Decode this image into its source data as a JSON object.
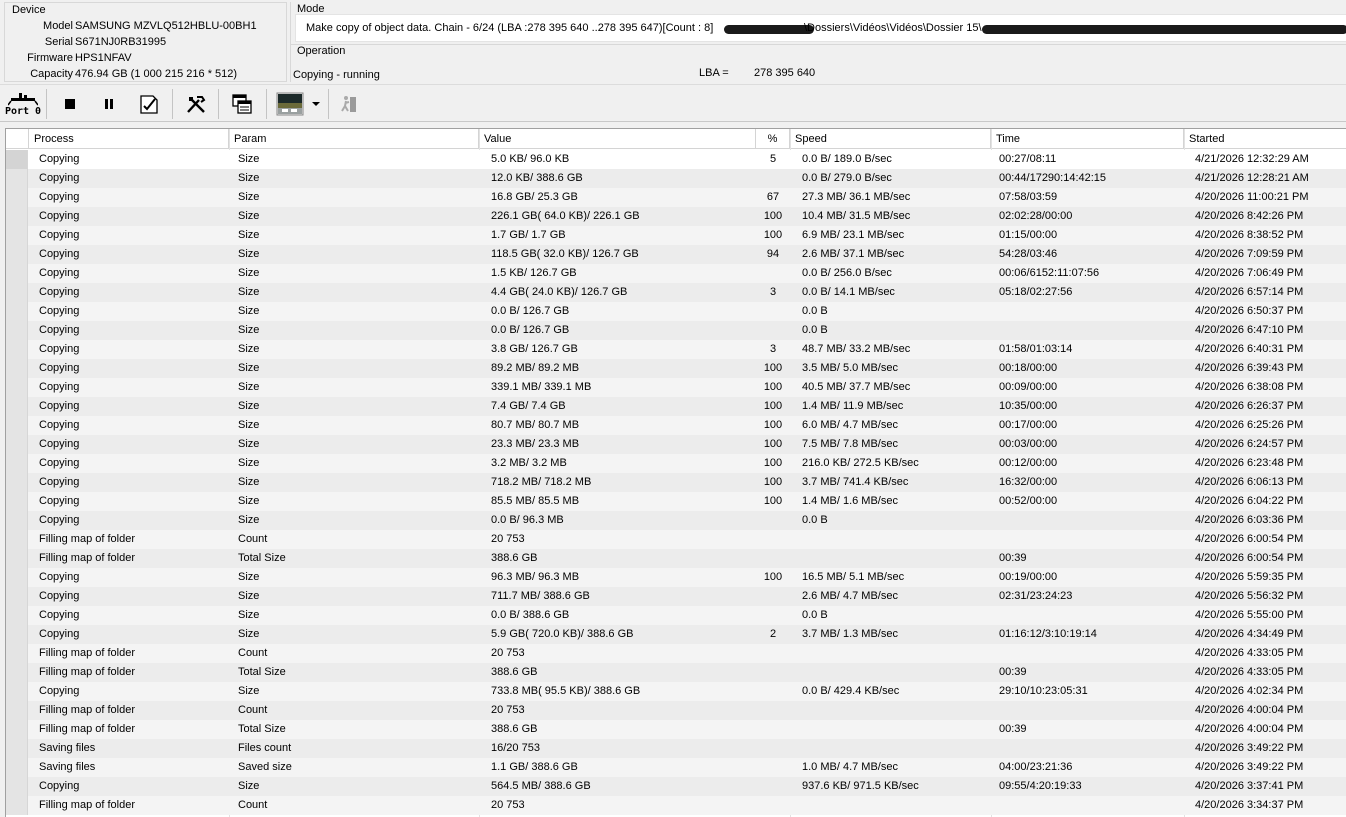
{
  "device": {
    "title": "Device",
    "model_label": "Model",
    "model": "SAMSUNG MZVLQ512HBLU-00BH1",
    "serial_label": "Serial",
    "serial": "S671NJ0RB31995",
    "firmware_label": "Firmware",
    "firmware": "HPS1NFAV",
    "capacity_label": "Capacity",
    "capacity": "476.94 GB (1 000 215 216 * 512)"
  },
  "mode": {
    "title": "Mode",
    "text": "Make copy of object data. Chain - 6/24 (LBA :278 395 640 ..278 395 647)[Count :   8]",
    "path_visible": "\\Dossiers\\Vidéos\\Vidéos\\Dossier 15\\"
  },
  "operation": {
    "title": "Operation",
    "status": "Copying - running",
    "lba_label": "LBA =",
    "lba_value": "278 395 640"
  },
  "toolbar": {
    "port_label": "Port 0",
    "icons": [
      "port-icon",
      "stop-icon",
      "pause-icon",
      "checklist-icon",
      "tools-icon",
      "copy-windows-icon",
      "thumbnail-icon",
      "dropdown-arrow-icon",
      "exit-icon"
    ]
  },
  "table": {
    "headers": [
      "Process",
      "Param",
      "Value",
      "%",
      "Speed",
      "Time",
      "Started"
    ],
    "rows": [
      [
        "Copying",
        "Size",
        "5.0 KB/ 96.0 KB",
        "5",
        "0.0 B/ 189.0 B/sec",
        "00:27/08:11",
        "4/21/2026 12:32:29 AM"
      ],
      [
        "Copying",
        "Size",
        "12.0 KB/ 388.6 GB",
        "",
        "0.0 B/ 279.0 B/sec",
        "00:44/17290:14:42:15",
        "4/21/2026 12:28:21 AM"
      ],
      [
        "Copying",
        "Size",
        "16.8 GB/ 25.3 GB",
        "67",
        "27.3 MB/ 36.1 MB/sec",
        "07:58/03:59",
        "4/20/2026 11:00:21 PM"
      ],
      [
        "Copying",
        "Size",
        "226.1 GB( 64.0 KB)/ 226.1 GB",
        "100",
        "10.4 MB/ 31.5 MB/sec",
        "02:02:28/00:00",
        "4/20/2026 8:42:26 PM"
      ],
      [
        "Copying",
        "Size",
        "1.7 GB/ 1.7 GB",
        "100",
        "6.9 MB/ 23.1 MB/sec",
        "01:15/00:00",
        "4/20/2026 8:38:52 PM"
      ],
      [
        "Copying",
        "Size",
        "118.5 GB( 32.0 KB)/ 126.7 GB",
        "94",
        "2.6 MB/ 37.1 MB/sec",
        "54:28/03:46",
        "4/20/2026 7:09:59 PM"
      ],
      [
        "Copying",
        "Size",
        "1.5 KB/ 126.7 GB",
        "",
        "0.0 B/ 256.0 B/sec",
        "00:06/6152:11:07:56",
        "4/20/2026 7:06:49 PM"
      ],
      [
        "Copying",
        "Size",
        "4.4 GB( 24.0 KB)/ 126.7 GB",
        "3",
        "0.0 B/ 14.1 MB/sec",
        "05:18/02:27:56",
        "4/20/2026 6:57:14 PM"
      ],
      [
        "Copying",
        "Size",
        "0.0 B/ 126.7 GB",
        "",
        "0.0 B",
        "",
        "4/20/2026 6:50:37 PM"
      ],
      [
        "Copying",
        "Size",
        "0.0 B/ 126.7 GB",
        "",
        "0.0 B",
        "",
        "4/20/2026 6:47:10 PM"
      ],
      [
        "Copying",
        "Size",
        "3.8 GB/ 126.7 GB",
        "3",
        "48.7 MB/ 33.2 MB/sec",
        "01:58/01:03:14",
        "4/20/2026 6:40:31 PM"
      ],
      [
        "Copying",
        "Size",
        "89.2 MB/ 89.2 MB",
        "100",
        "3.5 MB/ 5.0 MB/sec",
        "00:18/00:00",
        "4/20/2026 6:39:43 PM"
      ],
      [
        "Copying",
        "Size",
        "339.1 MB/ 339.1 MB",
        "100",
        "40.5 MB/ 37.7 MB/sec",
        "00:09/00:00",
        "4/20/2026 6:38:08 PM"
      ],
      [
        "Copying",
        "Size",
        "7.4 GB/ 7.4 GB",
        "100",
        "1.4 MB/ 11.9 MB/sec",
        "10:35/00:00",
        "4/20/2026 6:26:37 PM"
      ],
      [
        "Copying",
        "Size",
        "80.7 MB/ 80.7 MB",
        "100",
        "6.0 MB/ 4.7 MB/sec",
        "00:17/00:00",
        "4/20/2026 6:25:26 PM"
      ],
      [
        "Copying",
        "Size",
        "23.3 MB/ 23.3 MB",
        "100",
        "7.5 MB/ 7.8 MB/sec",
        "00:03/00:00",
        "4/20/2026 6:24:57 PM"
      ],
      [
        "Copying",
        "Size",
        "3.2 MB/ 3.2 MB",
        "100",
        "216.0 KB/ 272.5 KB/sec",
        "00:12/00:00",
        "4/20/2026 6:23:48 PM"
      ],
      [
        "Copying",
        "Size",
        "718.2 MB/ 718.2 MB",
        "100",
        "3.7 MB/ 741.4 KB/sec",
        "16:32/00:00",
        "4/20/2026 6:06:13 PM"
      ],
      [
        "Copying",
        "Size",
        "85.5 MB/ 85.5 MB",
        "100",
        "1.4 MB/ 1.6 MB/sec",
        "00:52/00:00",
        "4/20/2026 6:04:22 PM"
      ],
      [
        "Copying",
        "Size",
        "0.0 B/ 96.3 MB",
        "",
        "0.0 B",
        "",
        "4/20/2026 6:03:36 PM"
      ],
      [
        "Filling map of folder",
        "Count",
        "20 753",
        "",
        "",
        "",
        "4/20/2026 6:00:54 PM"
      ],
      [
        "Filling map of folder",
        "Total Size",
        "388.6 GB",
        "",
        "",
        "00:39",
        "4/20/2026 6:00:54 PM"
      ],
      [
        "Copying",
        "Size",
        "96.3 MB/ 96.3 MB",
        "100",
        "16.5 MB/ 5.1 MB/sec",
        "00:19/00:00",
        "4/20/2026 5:59:35 PM"
      ],
      [
        "Copying",
        "Size",
        "711.7 MB/ 388.6 GB",
        "",
        "2.6 MB/ 4.7 MB/sec",
        "02:31/23:24:23",
        "4/20/2026 5:56:32 PM"
      ],
      [
        "Copying",
        "Size",
        "0.0 B/ 388.6 GB",
        "",
        "0.0 B",
        "",
        "4/20/2026 5:55:00 PM"
      ],
      [
        "Copying",
        "Size",
        "5.9 GB( 720.0 KB)/ 388.6 GB",
        "2",
        "3.7 MB/ 1.3 MB/sec",
        "01:16:12/3:10:19:14",
        "4/20/2026 4:34:49 PM"
      ],
      [
        "Filling map of folder",
        "Count",
        "20 753",
        "",
        "",
        "",
        "4/20/2026 4:33:05 PM"
      ],
      [
        "Filling map of folder",
        "Total Size",
        "388.6 GB",
        "",
        "",
        "00:39",
        "4/20/2026 4:33:05 PM"
      ],
      [
        "Copying",
        "Size",
        "733.8 MB( 95.5 KB)/ 388.6 GB",
        "",
        "0.0 B/ 429.4 KB/sec",
        "29:10/10:23:05:31",
        "4/20/2026 4:02:34 PM"
      ],
      [
        "Filling map of folder",
        "Count",
        "20 753",
        "",
        "",
        "",
        "4/20/2026 4:00:04 PM"
      ],
      [
        "Filling map of folder",
        "Total Size",
        "388.6 GB",
        "",
        "",
        "00:39",
        "4/20/2026 4:00:04 PM"
      ],
      [
        "Saving files",
        "Files count",
        "16/20 753",
        "",
        "",
        "",
        "4/20/2026 3:49:22 PM"
      ],
      [
        "Saving files",
        "Saved size",
        "1.1 GB/ 388.6 GB",
        "",
        "1.0 MB/ 4.7 MB/sec",
        "04:00/23:21:36",
        "4/20/2026 3:49:22 PM"
      ],
      [
        "Copying",
        "Size",
        "564.5 MB/ 388.6 GB",
        "",
        "937.6 KB/ 971.5 KB/sec",
        "09:55/4:20:19:33",
        "4/20/2026 3:37:41 PM"
      ],
      [
        "Filling map of folder",
        "Count",
        "20 753",
        "",
        "",
        "",
        "4/20/2026 3:34:37 PM"
      ]
    ]
  }
}
